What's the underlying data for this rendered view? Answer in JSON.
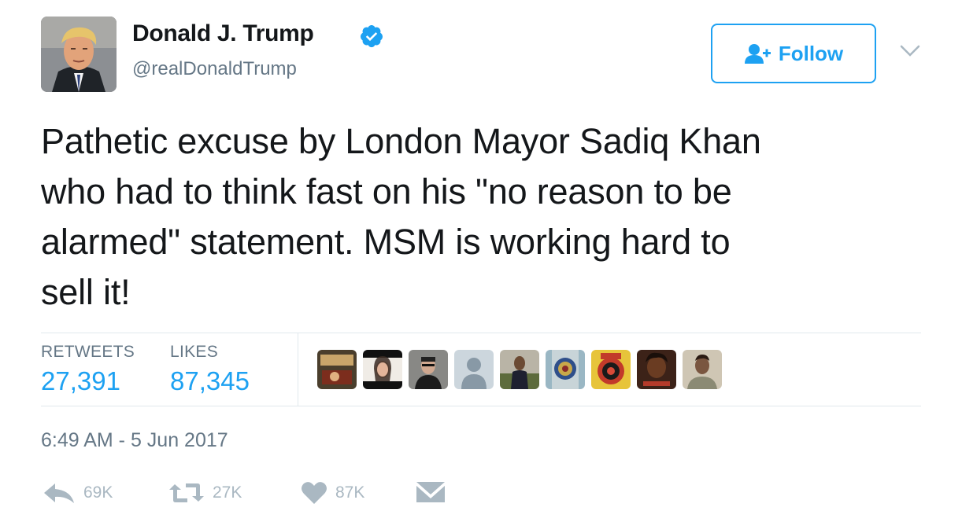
{
  "user": {
    "name": "Donald J. Trump",
    "handle": "@realDonaldTrump",
    "verified": true
  },
  "follow_button": {
    "label": "Follow",
    "icon": "add-user-icon"
  },
  "tweet": {
    "text_lines": [
      "Pathetic excuse by London Mayor Sadiq Khan",
      "who had to think fast on his \"no reason to be",
      "alarmed\" statement. MSM is working hard to",
      "sell it!"
    ]
  },
  "stats": {
    "retweets_label": "RETWEETS",
    "retweets_value": "27,391",
    "likes_label": "LIKES",
    "likes_value": "87,345"
  },
  "likers": [
    "liker-avatar",
    "liker-avatar",
    "liker-avatar",
    "default-avatar",
    "liker-avatar",
    "liker-avatar",
    "liker-avatar",
    "liker-avatar",
    "liker-avatar"
  ],
  "timestamp": "6:49 AM - 5 Jun 2017",
  "actions": {
    "reply_count": "69K",
    "retweet_count": "27K",
    "like_count": "87K"
  },
  "colors": {
    "accent": "#1da1f2",
    "text": "#14171a",
    "muted": "#657786",
    "icon": "#aab8c2",
    "divider": "#e1e8ed",
    "verified": "#1da1f2"
  }
}
